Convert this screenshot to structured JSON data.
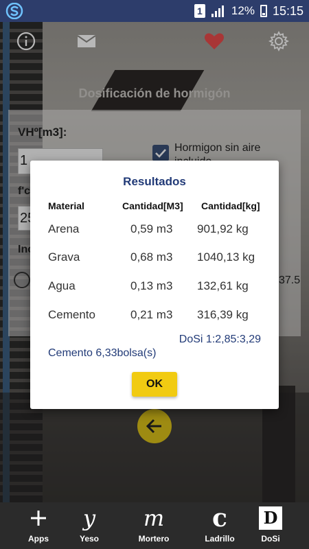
{
  "status_bar": {
    "sim": "1",
    "battery": "12%",
    "time": "15:15"
  },
  "toolbar": {
    "icons": [
      "info-icon",
      "mail-icon",
      "heart-icon",
      "gear-icon"
    ],
    "heart_color": "#e94b4b"
  },
  "app": {
    "title": "Dosificación de hormigón"
  },
  "form": {
    "vh_label": "VHº[m3]:",
    "vh_value": "1",
    "air_checkbox_label": "Hormigon sin aire incluido",
    "fc_label": "f'c",
    "fc_value": "25",
    "inc_label": "Inc",
    "peek_value": "37.5"
  },
  "dialog": {
    "title": "Resultados",
    "headers": [
      "Material",
      "Cantidad[M3]",
      "Cantidad[kg]"
    ],
    "rows": [
      {
        "material": "Arena",
        "m3": "0,59 m3",
        "kg": "901,92 kg"
      },
      {
        "material": "Grava",
        "m3": "0,68 m3",
        "kg": "1040,13 kg"
      },
      {
        "material": "Agua",
        "m3": "0,13 m3",
        "kg": "132,61 kg"
      },
      {
        "material": "Cemento",
        "m3": "0,21 m3",
        "kg": "316,39 kg"
      }
    ],
    "ratio": "DoSi 1:2,85:3,29",
    "bags": "Cemento 6,33bolsa(s)",
    "ok_label": "OK"
  },
  "fab": {
    "icon": "arrow-left-icon",
    "color": "#dcc11a"
  },
  "bottom_nav": {
    "items": [
      {
        "label": "Apps",
        "glyph": "+"
      },
      {
        "label": "Yeso",
        "glyph": "y"
      },
      {
        "label": "Mortero",
        "glyph": "m"
      },
      {
        "label": "Ladrillo",
        "glyph": "c"
      },
      {
        "label": "DoSi",
        "glyph": "D"
      }
    ]
  },
  "colors": {
    "status_bar": "#2d3d6b",
    "dialog_title": "#213a77",
    "ok_button": "#f1cb12",
    "nav_bar": "#2b2b2b"
  }
}
